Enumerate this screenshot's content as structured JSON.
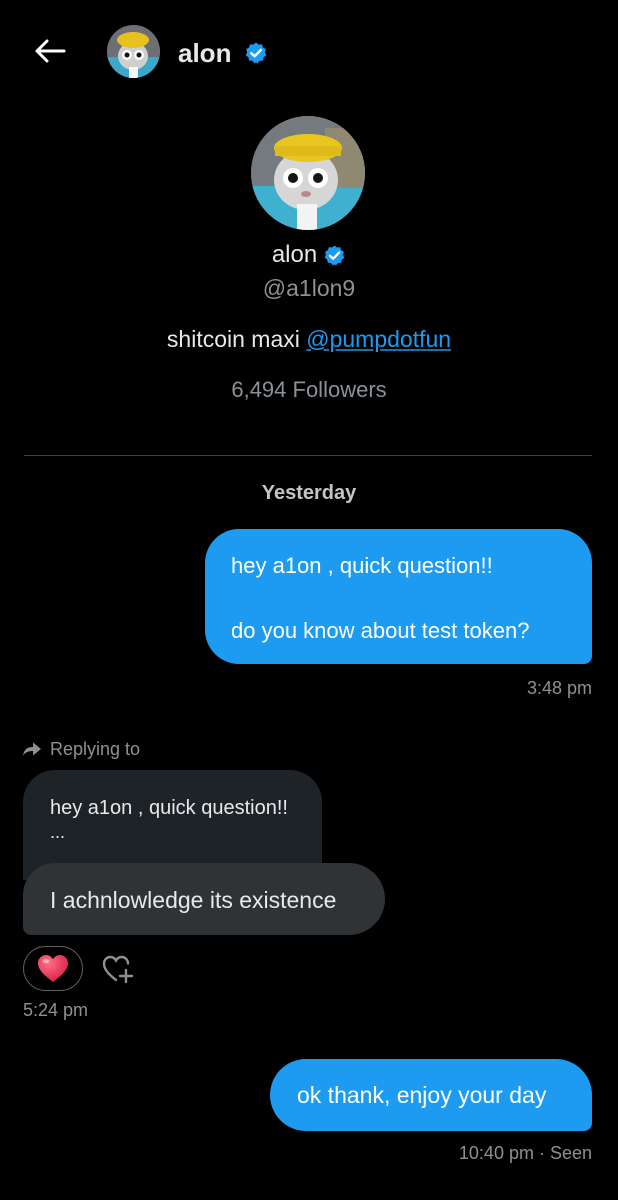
{
  "header": {
    "name": "alon"
  },
  "profile": {
    "name": "alon",
    "handle": "@a1lon9",
    "bio_text": "shitcoin maxi",
    "bio_link": "@pumpdotfun",
    "followers": "6,494 Followers"
  },
  "conversation": {
    "date_separator": "Yesterday",
    "messages": [
      {
        "direction": "outgoing",
        "lines": [
          "hey a1on , quick question!!",
          "do you know about test token?"
        ],
        "time": "3:48 pm"
      },
      {
        "direction": "incoming",
        "reply_label": "Replying to",
        "quoted_line": "hey a1on , quick question!!",
        "quoted_ellipsis": "...",
        "text": "I achnlowledge its existence",
        "reaction": "heart",
        "time": "5:24 pm"
      },
      {
        "direction": "outgoing",
        "text": "ok thank, enjoy your day",
        "time": "10:40 pm · Seen"
      }
    ]
  },
  "colors": {
    "accent": "#1d9bf0",
    "background": "#000000",
    "incoming_bubble": "#2f3336",
    "reaction_heart": "#e8264e"
  }
}
